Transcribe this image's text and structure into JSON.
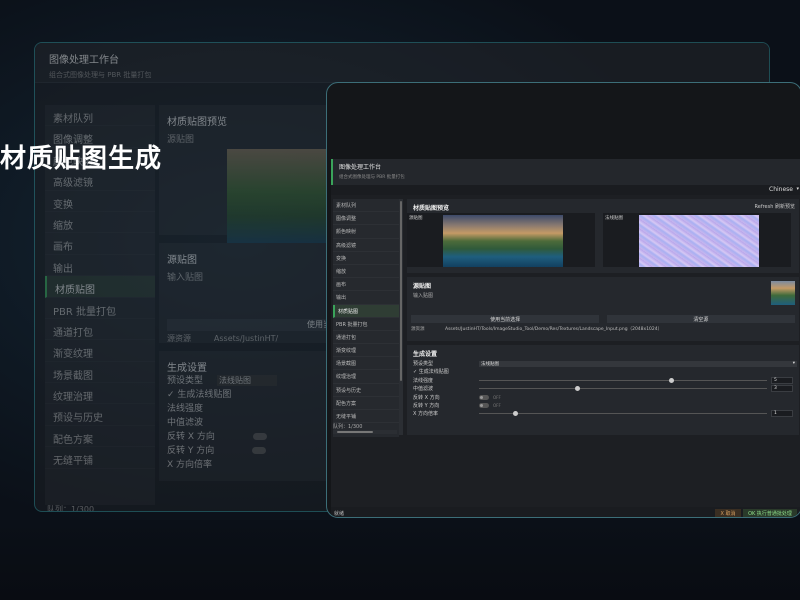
{
  "hero_title": "材质贴图生成",
  "app": {
    "title": "图像处理工作台",
    "subtitle": "组合式图像处理与 PBR 批量打包",
    "language": "Chinese"
  },
  "sidebar": {
    "items": [
      "素材队列",
      "图像调整",
      "颜色映射",
      "高级滤镜",
      "变换",
      "缩放",
      "画布",
      "输出",
      "材质贴图",
      "PBR 批量打包",
      "通道打包",
      "渐变纹理",
      "场景截图",
      "纹理治理",
      "预设与历史",
      "配色方案",
      "无缝平铺"
    ],
    "active_index": 8,
    "count": "队列：1/300"
  },
  "bg_sidebar": {
    "items": [
      "素材队列",
      "图像调整",
      "颜色映射",
      "高级滤镜",
      "变换",
      "缩放",
      "画布",
      "输出",
      "材质贴图",
      "PBR 批量打包",
      "通道打包",
      "渐变纹理",
      "场景截图",
      "纹理治理",
      "预设与历史",
      "配色方案",
      "无缝平铺"
    ],
    "active_index": 8,
    "count": "队列：1/300"
  },
  "preview": {
    "heading": "材质贴图预览",
    "refresh": "Refresh 刷新预览",
    "source_label": "源贴图",
    "output_label": "法线贴图"
  },
  "source": {
    "heading": "源贴图",
    "input_label": "输入贴图",
    "use_current": "使用当前选择",
    "clear": "清空源",
    "path_label": "源资源",
    "path_value": "Assets/JustinHT/Tools/ImageStudio_Tool/Demo/Res/Textures/Landscape_Input.png（2048x1024）"
  },
  "bg_source": {
    "use_current": "使用当前选",
    "path_value": "Assets/JustinHT/"
  },
  "generate": {
    "heading": "生成设置",
    "preset_label": "预设类型",
    "preset_value": "法线贴图",
    "checkbox": "✓ 生成法线贴图",
    "normal_strength_label": "法线强度",
    "normal_strength_value": "5",
    "median_label": "中值滤波",
    "median_value": "3",
    "flip_x_label": "反转 X 方向",
    "flip_y_label": "反转 Y 方向",
    "toggle_off": "OFF",
    "x_scale_label": "X 方向倍率",
    "x_scale_value": "1"
  },
  "status": {
    "text": "就绪",
    "cancel": "X 取消",
    "ok": "OK 执行普通批处理"
  }
}
